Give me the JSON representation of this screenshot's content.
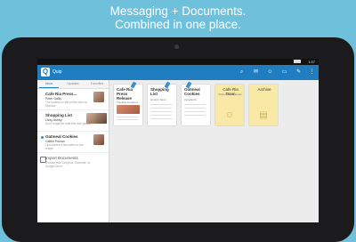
{
  "promo": {
    "line1": "Messaging + Documents.",
    "line2": "Combined in one place."
  },
  "status_bar": {
    "time": "1:57"
  },
  "app_bar": {
    "app_name": "Quip",
    "icons": [
      "search-icon",
      "chat-icon",
      "people-icon",
      "folder-icon",
      "compose-icon",
      "menu-icon"
    ]
  },
  "sidebar": {
    "tabs": [
      "Inbox",
      "Updates",
      "Favorites"
    ],
    "items": [
      {
        "title": "Cafe Ria Press...",
        "who": "Peter Galliy",
        "snippet": "The location is still on the plan on Monday"
      },
      {
        "title": "Shopping List",
        "who": "Lizzy Ashby",
        "snippet": "Don't forget the milk this time please"
      },
      {
        "title": "Oatmeal Cookies",
        "who": "Caitlin Pruvan",
        "snippet": "I just added a few notes to the recipe"
      },
      {
        "title": "Import Documents",
        "who": "",
        "snippet": "Choose from Dropbox, Evernote, or Google Drive"
      }
    ]
  },
  "documents": [
    {
      "title": "Cafe Ria Press Release",
      "sub": "The Best Locations",
      "style": "white"
    },
    {
      "title": "Shopping List",
      "sub": "Grocery Store",
      "style": "white"
    },
    {
      "title": "Oatmeal Cookies",
      "sub": "Ingredients",
      "style": "white"
    },
    {
      "title": "Cafe Ria Team",
      "sub": "Shared with 3 people",
      "style": "yellow"
    },
    {
      "title": "Archive",
      "sub": "",
      "style": "yellow"
    }
  ],
  "colors": {
    "accent": "#1f7dc0",
    "background": "#6fc0db",
    "folder": "#f8e9a6"
  }
}
